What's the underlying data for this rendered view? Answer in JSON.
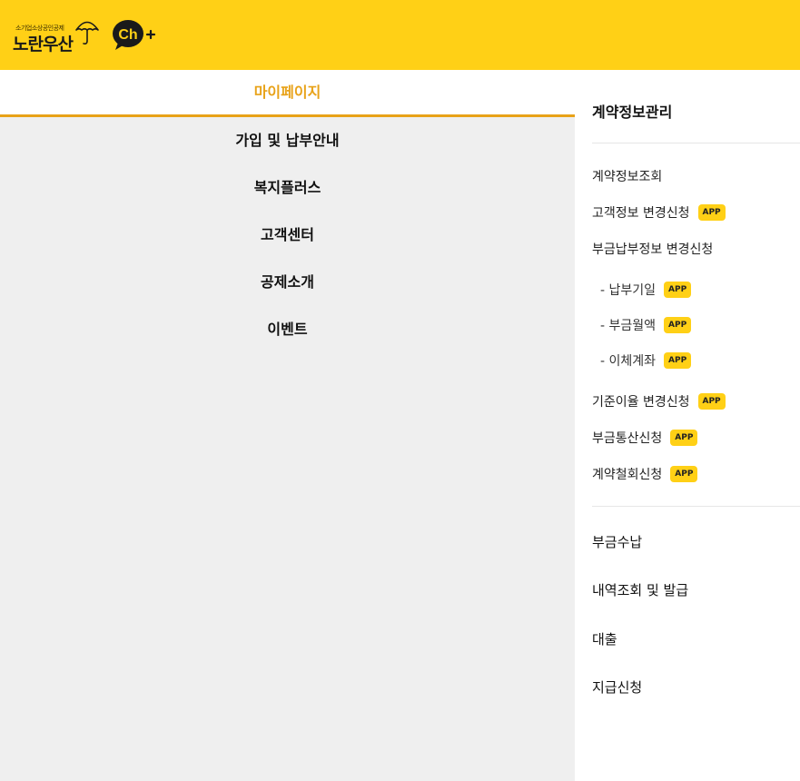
{
  "header": {
    "logo_subtitle": "소기업소상공인공제",
    "logo_title": "노란우산",
    "channel_icon": "kakao-channel-plus-icon",
    "brand_color": "#ffd016"
  },
  "left_nav": {
    "items": [
      {
        "label": "마이페이지",
        "active": true
      },
      {
        "label": "가입 및 납부안내"
      },
      {
        "label": "복지플러스"
      },
      {
        "label": "고객센터"
      },
      {
        "label": "공제소개"
      },
      {
        "label": "이벤트"
      }
    ],
    "active_color": "#e8a218"
  },
  "right_menu": {
    "section_title": "계약정보관리",
    "sub_items": [
      {
        "label": "계약정보조회"
      },
      {
        "label": "고객정보 변경신청",
        "badge": "APP"
      },
      {
        "label": "부금납부정보 변경신청"
      },
      {
        "label": "- 납부기일",
        "badge": "APP"
      },
      {
        "label": "- 부금월액",
        "badge": "APP"
      },
      {
        "label": "- 이체계좌",
        "badge": "APP"
      },
      {
        "label": "기준이율 변경신청",
        "badge": "APP"
      },
      {
        "label": "부금통산신청",
        "badge": "APP"
      },
      {
        "label": "계약철회신청",
        "badge": "APP"
      }
    ],
    "main_items": [
      {
        "label": "부금수납"
      },
      {
        "label": "내역조회 및 발급"
      },
      {
        "label": "대출"
      },
      {
        "label": "지급신청"
      }
    ]
  }
}
